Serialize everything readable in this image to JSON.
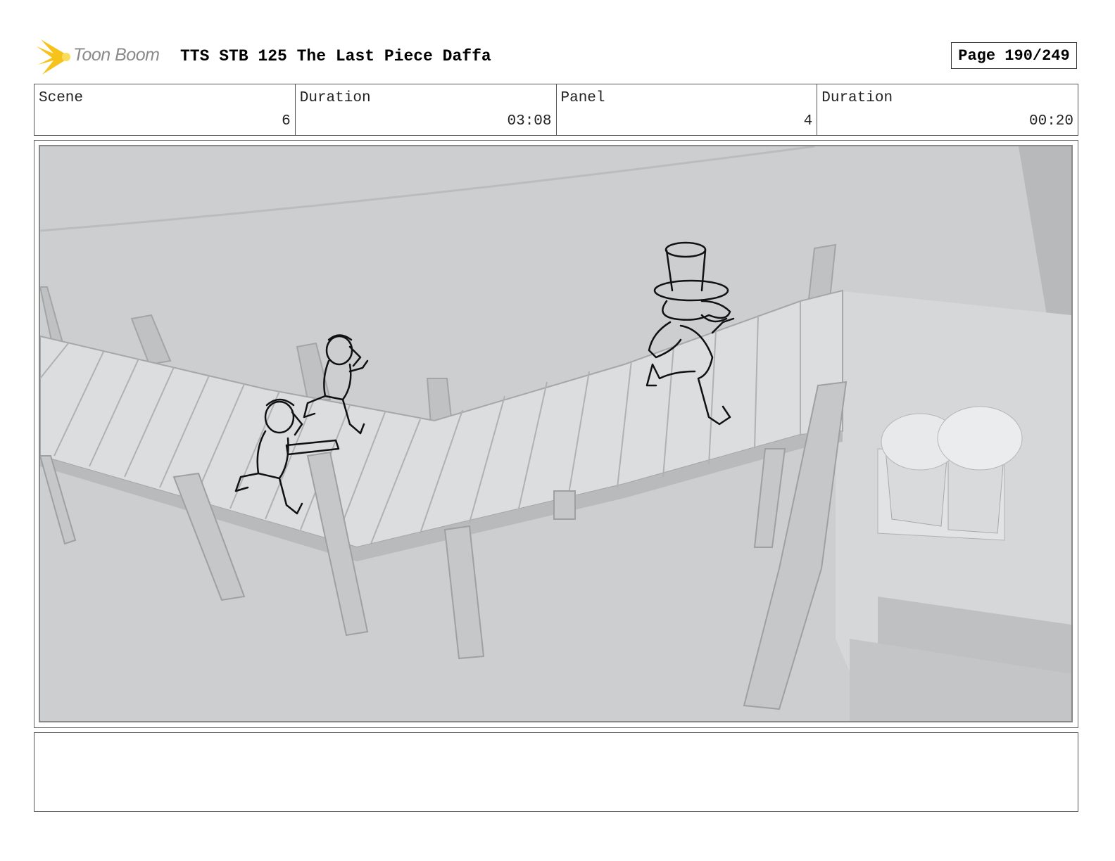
{
  "header": {
    "logo_text": "Toon Boom",
    "title": "TTS STB 125 The Last Piece Daffa",
    "page": "Page 190/249"
  },
  "info": {
    "scene_label": "Scene",
    "scene_value": "6",
    "scene_duration_label": "Duration",
    "scene_duration_value": "03:08",
    "panel_label": "Panel",
    "panel_value": "4",
    "panel_duration_label": "Duration",
    "panel_duration_value": "00:20"
  },
  "notes": {
    "text": ""
  },
  "colors": {
    "background": "#cdcecf",
    "logo_accent": "#f6c31a",
    "sketch_line": "#111111"
  }
}
